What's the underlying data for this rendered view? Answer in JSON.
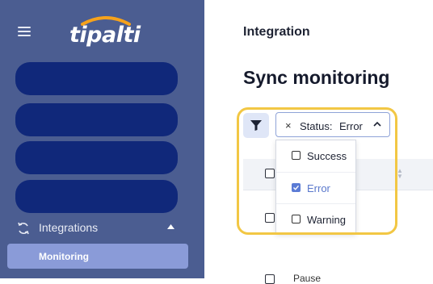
{
  "sidebar": {
    "logo_text": "tipalti",
    "integrations_label": "Integrations",
    "monitoring_label": "Monitoring"
  },
  "header": {
    "breadcrumb": "Integration",
    "title": "Sync monitoring"
  },
  "filter": {
    "chip_key": "Status:",
    "chip_value": "Error",
    "chip_remove_glyph": "×",
    "options": [
      {
        "label": "Success",
        "checked": false
      },
      {
        "label": "Error",
        "checked": true
      },
      {
        "label": "Warning",
        "checked": false
      }
    ]
  },
  "table": {
    "partial_row_text": "Pause"
  },
  "colors": {
    "sidebar": "#4b5d91",
    "nav_pill": "#10287a",
    "active_item": "#8a9bd8",
    "highlight": "#f2c744",
    "accent": "#5b7bd5"
  }
}
